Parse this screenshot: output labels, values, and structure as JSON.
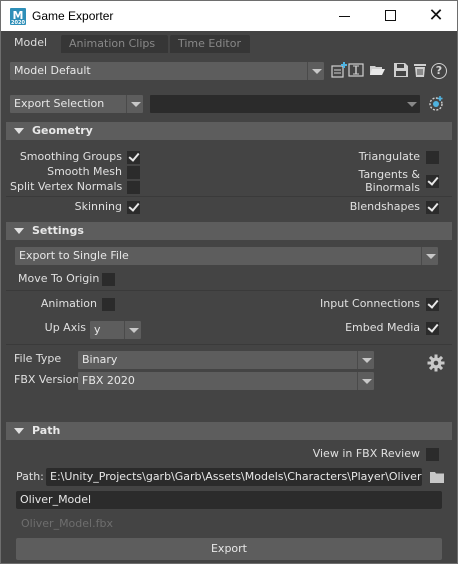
{
  "window": {
    "title": "Game Exporter",
    "icon_letter": "M",
    "icon_sub": "2020",
    "minimize_icon": "minimize-icon",
    "maximize_icon": "maximize-icon",
    "close_icon": "close-icon",
    "close_glyph": "✕"
  },
  "tabs": [
    {
      "label": "Model",
      "active": true
    },
    {
      "label": "Animation Clips",
      "active": false
    },
    {
      "label": "Time Editor",
      "active": false
    }
  ],
  "preset": {
    "value": "Model Default",
    "icons": [
      "add-preset-icon",
      "edit-preset-icon",
      "open-folder-icon",
      "save-icon",
      "delete-icon",
      "help-icon"
    ],
    "help_glyph": "?"
  },
  "export_mode": {
    "value": "Export Selection",
    "secondary_value": "",
    "select_icon": "selection-set-icon"
  },
  "geometry": {
    "header": "Geometry",
    "smoothing_groups": {
      "label": "Smoothing Groups",
      "checked": true
    },
    "smooth_mesh": {
      "label": "Smooth Mesh",
      "checked": false
    },
    "split_vertex_normals": {
      "label": "Split Vertex Normals",
      "checked": false
    },
    "triangulate": {
      "label": "Triangulate",
      "checked": false
    },
    "tangents_binormals": {
      "label_line1": "Tangents &",
      "label_line2": "Binormals",
      "checked": true
    },
    "skinning": {
      "label": "Skinning",
      "checked": true
    },
    "blendshapes": {
      "label": "Blendshapes",
      "checked": true
    }
  },
  "settings": {
    "header": "Settings",
    "export_to": "Export to Single File",
    "move_to_origin": {
      "label": "Move To Origin",
      "checked": false
    },
    "animation": {
      "label": "Animation",
      "checked": false
    },
    "input_connections": {
      "label": "Input Connections",
      "checked": true
    },
    "up_axis": {
      "label": "Up Axis",
      "value": "y"
    },
    "embed_media": {
      "label": "Embed Media",
      "checked": true
    },
    "file_type": {
      "label": "File Type",
      "value": "Binary"
    },
    "fbx_version": {
      "label": "FBX Version",
      "value": "FBX 2020"
    },
    "settings_icon": "gear-icon"
  },
  "path": {
    "header": "Path",
    "view_in_fbx_review": {
      "label": "View in FBX Review",
      "checked": false
    },
    "path_label": "Path:",
    "path_value": "E:\\Unity_Projects\\garb\\Garb\\Assets\\Models\\Characters\\Player\\Oliver",
    "browse_icon": "folder-icon",
    "filename": "Oliver_Model",
    "output_file": "Oliver_Model.fbx"
  },
  "export_button": "Export"
}
